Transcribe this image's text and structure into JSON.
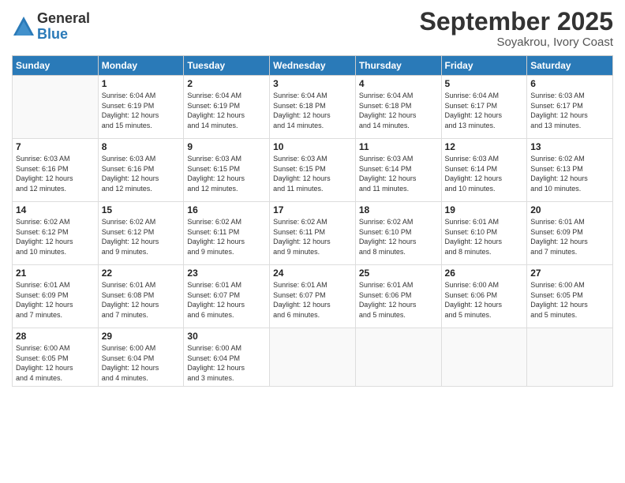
{
  "header": {
    "logo_general": "General",
    "logo_blue": "Blue",
    "month_title": "September 2025",
    "location": "Soyakrou, Ivory Coast"
  },
  "days_of_week": [
    "Sunday",
    "Monday",
    "Tuesday",
    "Wednesday",
    "Thursday",
    "Friday",
    "Saturday"
  ],
  "weeks": [
    [
      {
        "day": "",
        "info": ""
      },
      {
        "day": "1",
        "info": "Sunrise: 6:04 AM\nSunset: 6:19 PM\nDaylight: 12 hours\nand 15 minutes."
      },
      {
        "day": "2",
        "info": "Sunrise: 6:04 AM\nSunset: 6:19 PM\nDaylight: 12 hours\nand 14 minutes."
      },
      {
        "day": "3",
        "info": "Sunrise: 6:04 AM\nSunset: 6:18 PM\nDaylight: 12 hours\nand 14 minutes."
      },
      {
        "day": "4",
        "info": "Sunrise: 6:04 AM\nSunset: 6:18 PM\nDaylight: 12 hours\nand 14 minutes."
      },
      {
        "day": "5",
        "info": "Sunrise: 6:04 AM\nSunset: 6:17 PM\nDaylight: 12 hours\nand 13 minutes."
      },
      {
        "day": "6",
        "info": "Sunrise: 6:03 AM\nSunset: 6:17 PM\nDaylight: 12 hours\nand 13 minutes."
      }
    ],
    [
      {
        "day": "7",
        "info": "Sunrise: 6:03 AM\nSunset: 6:16 PM\nDaylight: 12 hours\nand 12 minutes."
      },
      {
        "day": "8",
        "info": "Sunrise: 6:03 AM\nSunset: 6:16 PM\nDaylight: 12 hours\nand 12 minutes."
      },
      {
        "day": "9",
        "info": "Sunrise: 6:03 AM\nSunset: 6:15 PM\nDaylight: 12 hours\nand 12 minutes."
      },
      {
        "day": "10",
        "info": "Sunrise: 6:03 AM\nSunset: 6:15 PM\nDaylight: 12 hours\nand 11 minutes."
      },
      {
        "day": "11",
        "info": "Sunrise: 6:03 AM\nSunset: 6:14 PM\nDaylight: 12 hours\nand 11 minutes."
      },
      {
        "day": "12",
        "info": "Sunrise: 6:03 AM\nSunset: 6:14 PM\nDaylight: 12 hours\nand 10 minutes."
      },
      {
        "day": "13",
        "info": "Sunrise: 6:02 AM\nSunset: 6:13 PM\nDaylight: 12 hours\nand 10 minutes."
      }
    ],
    [
      {
        "day": "14",
        "info": "Sunrise: 6:02 AM\nSunset: 6:12 PM\nDaylight: 12 hours\nand 10 minutes."
      },
      {
        "day": "15",
        "info": "Sunrise: 6:02 AM\nSunset: 6:12 PM\nDaylight: 12 hours\nand 9 minutes."
      },
      {
        "day": "16",
        "info": "Sunrise: 6:02 AM\nSunset: 6:11 PM\nDaylight: 12 hours\nand 9 minutes."
      },
      {
        "day": "17",
        "info": "Sunrise: 6:02 AM\nSunset: 6:11 PM\nDaylight: 12 hours\nand 9 minutes."
      },
      {
        "day": "18",
        "info": "Sunrise: 6:02 AM\nSunset: 6:10 PM\nDaylight: 12 hours\nand 8 minutes."
      },
      {
        "day": "19",
        "info": "Sunrise: 6:01 AM\nSunset: 6:10 PM\nDaylight: 12 hours\nand 8 minutes."
      },
      {
        "day": "20",
        "info": "Sunrise: 6:01 AM\nSunset: 6:09 PM\nDaylight: 12 hours\nand 7 minutes."
      }
    ],
    [
      {
        "day": "21",
        "info": "Sunrise: 6:01 AM\nSunset: 6:09 PM\nDaylight: 12 hours\nand 7 minutes."
      },
      {
        "day": "22",
        "info": "Sunrise: 6:01 AM\nSunset: 6:08 PM\nDaylight: 12 hours\nand 7 minutes."
      },
      {
        "day": "23",
        "info": "Sunrise: 6:01 AM\nSunset: 6:07 PM\nDaylight: 12 hours\nand 6 minutes."
      },
      {
        "day": "24",
        "info": "Sunrise: 6:01 AM\nSunset: 6:07 PM\nDaylight: 12 hours\nand 6 minutes."
      },
      {
        "day": "25",
        "info": "Sunrise: 6:01 AM\nSunset: 6:06 PM\nDaylight: 12 hours\nand 5 minutes."
      },
      {
        "day": "26",
        "info": "Sunrise: 6:00 AM\nSunset: 6:06 PM\nDaylight: 12 hours\nand 5 minutes."
      },
      {
        "day": "27",
        "info": "Sunrise: 6:00 AM\nSunset: 6:05 PM\nDaylight: 12 hours\nand 5 minutes."
      }
    ],
    [
      {
        "day": "28",
        "info": "Sunrise: 6:00 AM\nSunset: 6:05 PM\nDaylight: 12 hours\nand 4 minutes."
      },
      {
        "day": "29",
        "info": "Sunrise: 6:00 AM\nSunset: 6:04 PM\nDaylight: 12 hours\nand 4 minutes."
      },
      {
        "day": "30",
        "info": "Sunrise: 6:00 AM\nSunset: 6:04 PM\nDaylight: 12 hours\nand 3 minutes."
      },
      {
        "day": "",
        "info": ""
      },
      {
        "day": "",
        "info": ""
      },
      {
        "day": "",
        "info": ""
      },
      {
        "day": "",
        "info": ""
      }
    ]
  ]
}
